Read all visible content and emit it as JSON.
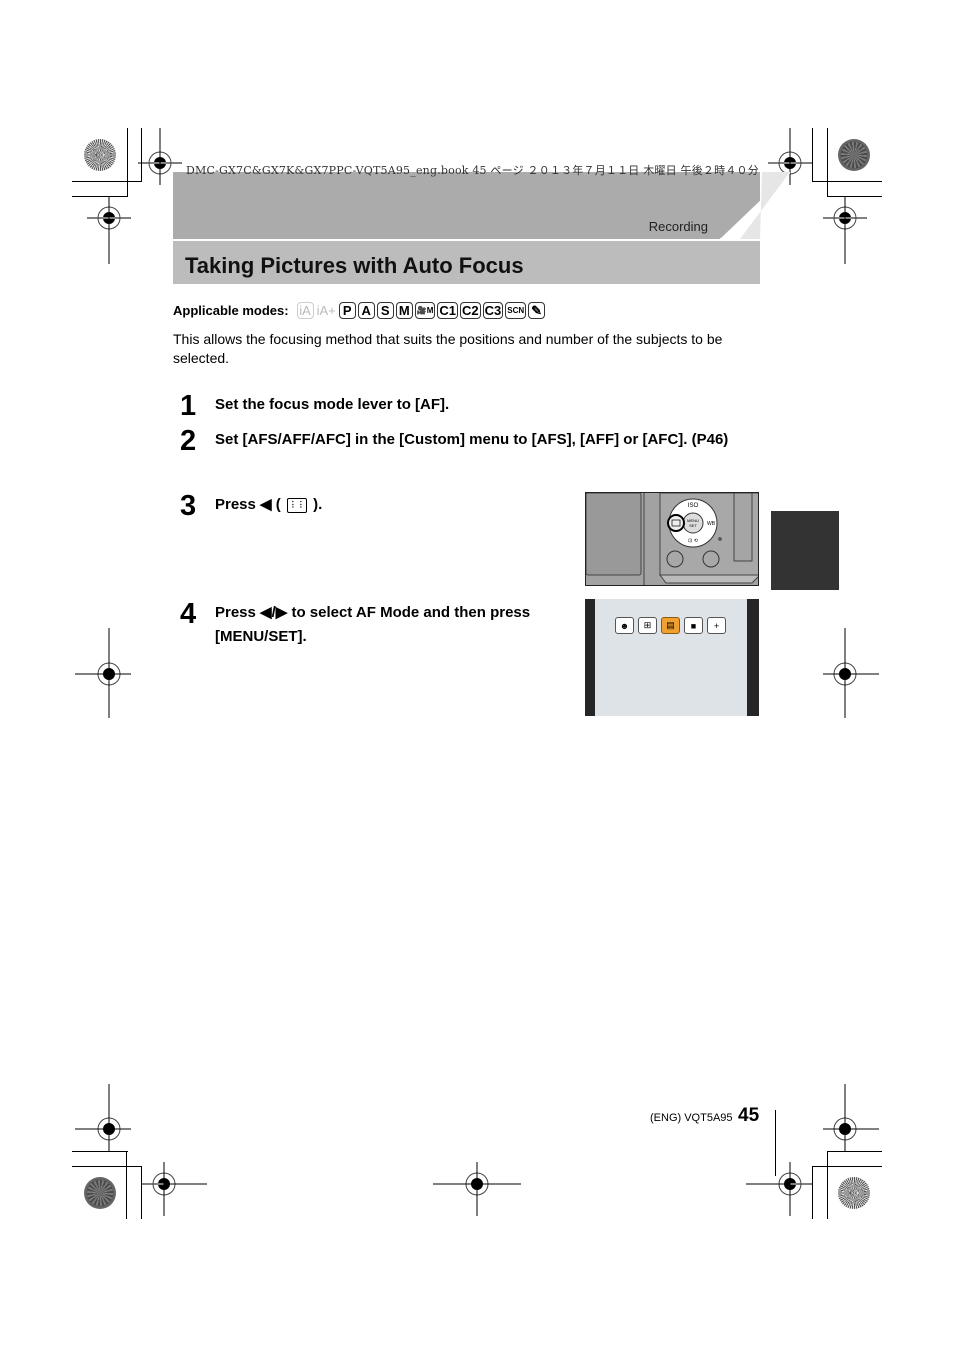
{
  "print_header": {
    "meta_text": "DMC-GX7C&GX7K&GX7PPC-VQT5A95_eng.book  45 ページ  ２０１３年７月１１日  木曜日  午後２時４０分"
  },
  "section": {
    "label": "Recording"
  },
  "page": {
    "title": "Taking Pictures with Auto Focus",
    "applicable_modes_label": "Applicable modes:",
    "applicable_modes": [
      {
        "label": "iA",
        "enabled": false,
        "icon": "intelligent-auto-icon"
      },
      {
        "label": "iA+",
        "enabled": false,
        "icon": "intelligent-auto-plus-icon"
      },
      {
        "label": "P",
        "enabled": true,
        "icon": "program-mode-icon"
      },
      {
        "label": "A",
        "enabled": true,
        "icon": "aperture-priority-icon"
      },
      {
        "label": "S",
        "enabled": true,
        "icon": "shutter-priority-icon"
      },
      {
        "label": "M",
        "enabled": true,
        "icon": "manual-mode-icon"
      },
      {
        "label": "🎥M",
        "enabled": true,
        "icon": "creative-video-icon"
      },
      {
        "label": "C1",
        "enabled": true,
        "icon": "custom-1-icon"
      },
      {
        "label": "C2",
        "enabled": true,
        "icon": "custom-2-icon"
      },
      {
        "label": "C3",
        "enabled": true,
        "icon": "custom-3-icon"
      },
      {
        "label": "SCN",
        "enabled": true,
        "icon": "scene-mode-icon"
      },
      {
        "label": "✎",
        "enabled": true,
        "icon": "creative-control-icon"
      }
    ],
    "intro": "This allows the focusing method that suits the positions and number of the subjects to be selected.",
    "steps": [
      {
        "number": "1",
        "text": "Set the focus mode lever to [AF]."
      },
      {
        "number": "2",
        "text": "Set [AFS/AFF/AFC] in the [Custom] menu to [AFS], [AFF] or [AFC]. (P46)"
      },
      {
        "number": "3",
        "text_before": "Press ◀ (",
        "icon": "af-mode-icon",
        "text_after": ")."
      },
      {
        "number": "4",
        "text": "Press ◀/▶ to select AF Mode and then press [MENU/SET]."
      }
    ]
  },
  "camera_illustration": {
    "buttons": [
      "ISO",
      "MENU/SET",
      "WB",
      "AF"
    ]
  },
  "lcd_screen": {
    "af_modes": [
      {
        "name": "face-detection",
        "selected": false
      },
      {
        "name": "af-tracking",
        "selected": false
      },
      {
        "name": "23-area",
        "selected": true
      },
      {
        "name": "1-area",
        "selected": false
      },
      {
        "name": "pinpoint",
        "selected": false
      }
    ],
    "selected_color": "#f0a030"
  },
  "footer": {
    "code": "(ENG) VQT5A95",
    "page_number": "45"
  }
}
